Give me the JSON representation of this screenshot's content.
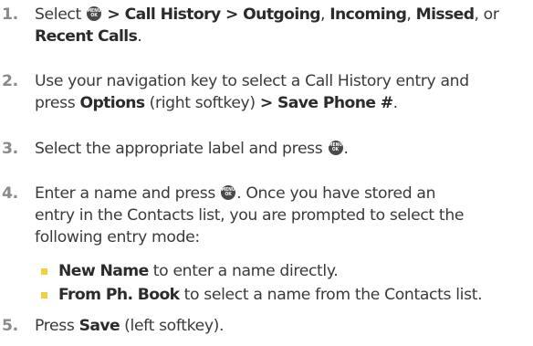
{
  "ok_icon": {
    "label_top": "MENU",
    "label_bottom": "OK",
    "color": "#4a4a4a"
  },
  "bullet_color": "#f2d23a",
  "steps": [
    {
      "num": "1.",
      "a": "Select ",
      "b": " > Call History > Outgoing",
      "c": ", ",
      "d": "Incoming",
      "e": ", ",
      "f": "Missed",
      "g": ", or",
      "h": "Recent Calls",
      "i": "."
    },
    {
      "num": "2.",
      "a": "Use your navigation key to select a Call History entry and",
      "b": "press ",
      "c": "Options",
      "d": " (right softkey) ",
      "e": "> Save Phone #",
      "f": "."
    },
    {
      "num": "3.",
      "a": "Select the appropriate label and press ",
      "b": "."
    },
    {
      "num": "4.",
      "a": "Enter a name and press ",
      "b": ". Once you have stored an",
      "c": "entry in the Contacts list, you are prompted to select the",
      "d": "following entry mode:"
    },
    {
      "num": "5.",
      "a": "Press ",
      "b": "Save",
      "c": " (left softkey)."
    }
  ],
  "sub_items": [
    {
      "bold": "New Name",
      "text": " to enter a name directly."
    },
    {
      "bold": "From Ph. Book",
      "text": " to select a name from the Contacts list."
    }
  ]
}
